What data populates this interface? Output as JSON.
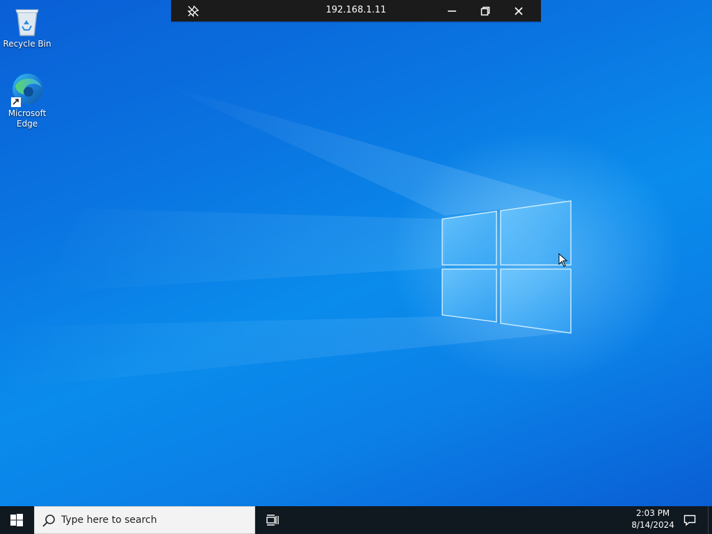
{
  "rdp_bar": {
    "title": "192.168.1.11",
    "icons": [
      "unpin-icon",
      "minimize-icon",
      "restore-icon",
      "close-icon"
    ]
  },
  "desktop": {
    "icons": [
      {
        "label": "Recycle Bin",
        "icon": "recycle-bin-icon"
      },
      {
        "label": "Microsoft Edge",
        "icon": "edge-icon"
      }
    ],
    "wallpaper": "windows-10-hero",
    "accent": "#0a74e0"
  },
  "taskbar": {
    "start_icon": "windows-start-icon",
    "search_placeholder": "Type here to search",
    "task_view_icon": "task-view-icon",
    "time": "2:03 PM",
    "date": "8/14/2024",
    "notification_icon": "action-center-icon"
  }
}
